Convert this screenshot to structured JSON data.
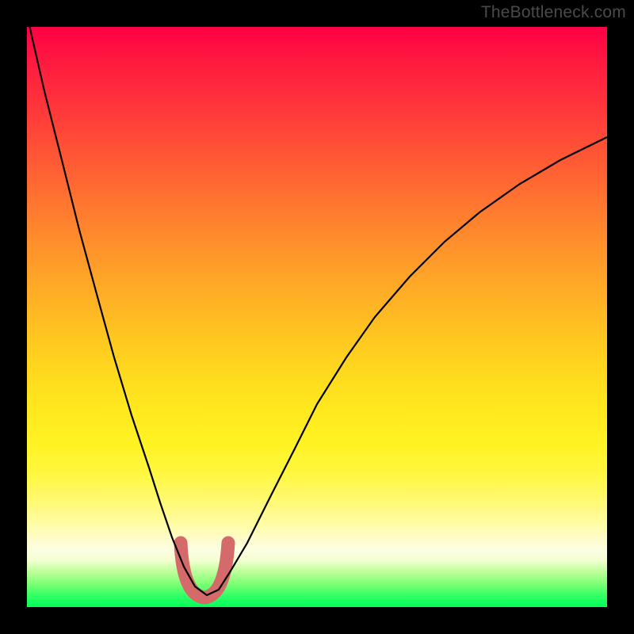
{
  "watermark": "TheBottleneck.com",
  "colors": {
    "background": "#000000",
    "curve": "#000000",
    "marker": "#d46a6a",
    "gradient_top": "#ff0044",
    "gradient_bottom": "#00ff5a"
  },
  "chart_data": {
    "type": "line",
    "title": "",
    "xlabel": "",
    "ylabel": "",
    "xlim": [
      0,
      100
    ],
    "ylim": [
      0,
      100
    ],
    "grid": false,
    "legend": false,
    "series": [
      {
        "name": "bottleneck-curve",
        "x": [
          0,
          3,
          6,
          9,
          12,
          15,
          18,
          21,
          23,
          25,
          27,
          29,
          31,
          33,
          35,
          38,
          42,
          46,
          50,
          55,
          60,
          66,
          72,
          78,
          85,
          92,
          100
        ],
        "y": [
          102,
          89,
          77,
          65,
          54,
          43,
          33,
          24,
          18,
          12,
          7,
          3.5,
          2,
          3,
          6,
          11,
          19,
          27,
          35,
          43,
          50,
          57,
          63,
          68,
          73,
          77,
          81
        ]
      }
    ],
    "annotations": [
      {
        "name": "trough-marker",
        "shape": "U",
        "x_range": [
          26.5,
          34.5
        ],
        "y_range": [
          2,
          11
        ],
        "color": "#d46a6a"
      }
    ]
  }
}
